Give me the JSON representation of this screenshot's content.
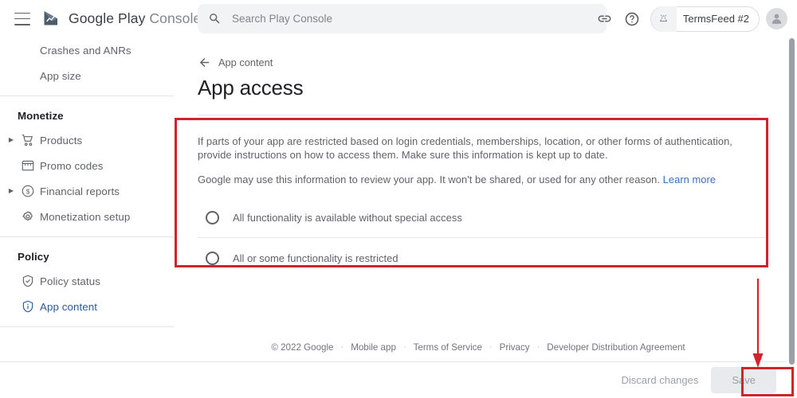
{
  "brand": {
    "name_bold": "Google Play",
    "name_light": "Console",
    "logo_icon": "play-console-logo",
    "menu_icon": "hamburger-menu-icon"
  },
  "search": {
    "placeholder": "Search Play Console",
    "value": "",
    "icon": "search-icon"
  },
  "topbar": {
    "link_icon": "link-icon",
    "help_icon": "help-circle-icon",
    "account_chip_label": "TermsFeed #2",
    "account_chip_icon": "android-app-icon",
    "avatar_icon": "user-avatar-icon"
  },
  "sidebar": {
    "items_top": [
      {
        "label": "Crashes and ANRs",
        "icon": null,
        "expandable": false,
        "active": false
      },
      {
        "label": "App size",
        "icon": null,
        "expandable": false,
        "active": false
      }
    ],
    "sections": [
      {
        "heading": "Monetize",
        "items": [
          {
            "label": "Products",
            "icon": "shopping-cart-icon",
            "expandable": true,
            "active": false
          },
          {
            "label": "Promo codes",
            "icon": "storefront-icon",
            "expandable": false,
            "active": false
          },
          {
            "label": "Financial reports",
            "icon": "dollar-circle-icon",
            "expandable": true,
            "active": false
          },
          {
            "label": "Monetization setup",
            "icon": "gear-icon",
            "expandable": false,
            "active": false
          }
        ]
      },
      {
        "heading": "Policy",
        "items": [
          {
            "label": "Policy status",
            "icon": "shield-check-icon",
            "expandable": false,
            "active": false
          },
          {
            "label": "App content",
            "icon": "shield-info-icon",
            "expandable": false,
            "active": true
          }
        ]
      }
    ]
  },
  "main": {
    "back_label": "App content",
    "back_icon": "arrow-left-icon",
    "title": "App access",
    "paragraph_1": "If parts of your app are restricted based on login credentials, memberships, location, or other forms of authentication, provide instructions on how to access them. Make sure this information is kept up to date.",
    "paragraph_2": "Google may use this information to review your app. It won't be shared, or used for any other reason.",
    "learn_more": "Learn more",
    "options": [
      {
        "label": "All functionality is available without special access",
        "selected": false
      },
      {
        "label": "All or some functionality is restricted",
        "selected": false
      }
    ]
  },
  "footer": {
    "copyright": "© 2022 Google",
    "links": [
      "Mobile app",
      "Terms of Service",
      "Privacy",
      "Developer Distribution Agreement"
    ],
    "separator": "·"
  },
  "actionbar": {
    "discard_label": "Discard changes",
    "save_label": "Save",
    "save_enabled": false
  },
  "annotations": {
    "color": "#d0232b",
    "box_main": "highlight-options-card",
    "box_save": "highlight-save-button",
    "arrow": "arrow-pointing-to-save"
  }
}
